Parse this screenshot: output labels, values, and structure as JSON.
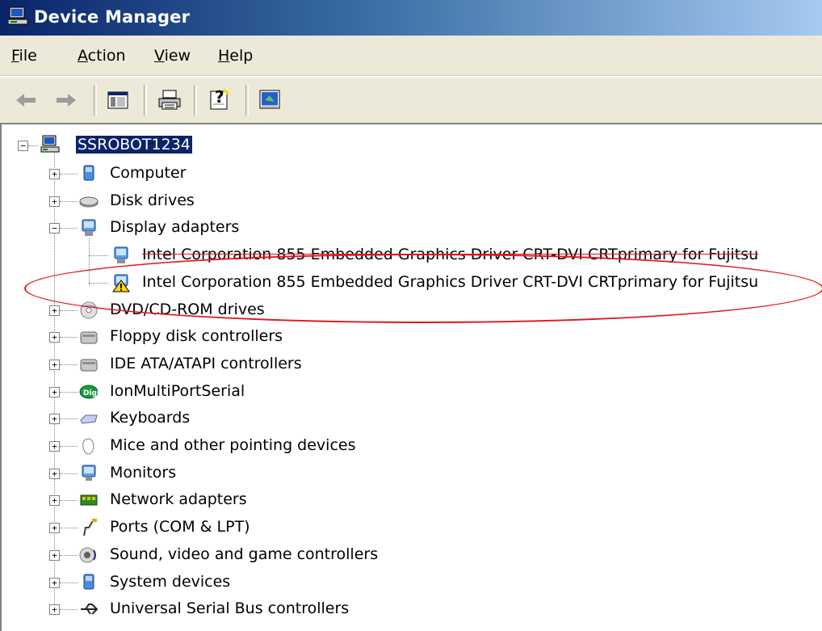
{
  "window": {
    "title": "Device Manager"
  },
  "menu": [
    {
      "label": "File",
      "key": "F"
    },
    {
      "label": "Action",
      "key": "A"
    },
    {
      "label": "View",
      "key": "V"
    },
    {
      "label": "Help",
      "key": "H"
    }
  ],
  "toolbar": {
    "buttons": [
      "back-arrow-icon",
      "forward-arrow-icon",
      "show-hide-console-tree-icon",
      "print-icon",
      "help-icon",
      "properties-icon"
    ]
  },
  "tree": {
    "root": "SSROBOT1234",
    "categories": [
      {
        "label": "Computer",
        "icon": "computer-icon",
        "expanded": false
      },
      {
        "label": "Disk drives",
        "icon": "disk-drive-icon",
        "expanded": false
      },
      {
        "label": "Display adapters",
        "icon": "display-adapter-icon",
        "expanded": true,
        "children": [
          {
            "label": "Intel Corporation 855 Embedded Graphics Driver CRT-DVI CRTprimary for Fujitsu",
            "icon": "display-adapter-icon",
            "warning": false,
            "strikethrough": true
          },
          {
            "label": "Intel Corporation 855 Embedded Graphics Driver CRT-DVI CRTprimary for Fujitsu",
            "icon": "display-adapter-warning-icon",
            "warning": true,
            "strikethrough": false
          }
        ]
      },
      {
        "label": "DVD/CD-ROM drives",
        "icon": "dvd-drive-icon",
        "expanded": false
      },
      {
        "label": "Floppy disk controllers",
        "icon": "floppy-controller-icon",
        "expanded": false
      },
      {
        "label": "IDE ATA/ATAPI controllers",
        "icon": "ide-controller-icon",
        "expanded": false
      },
      {
        "label": "IonMultiPortSerial",
        "icon": "digi-multiport-icon",
        "expanded": false
      },
      {
        "label": "Keyboards",
        "icon": "keyboard-icon",
        "expanded": false
      },
      {
        "label": "Mice and other pointing devices",
        "icon": "mouse-icon",
        "expanded": false
      },
      {
        "label": "Monitors",
        "icon": "monitor-icon",
        "expanded": false
      },
      {
        "label": "Network adapters",
        "icon": "network-adapter-icon",
        "expanded": false
      },
      {
        "label": "Ports (COM & LPT)",
        "icon": "port-icon",
        "expanded": false
      },
      {
        "label": "Sound, video and game controllers",
        "icon": "sound-icon",
        "expanded": false
      },
      {
        "label": "System devices",
        "icon": "system-device-icon",
        "expanded": false
      },
      {
        "label": "Universal Serial Bus controllers",
        "icon": "usb-icon",
        "expanded": false
      }
    ]
  },
  "colors": {
    "title_start": "#0a246a",
    "title_end": "#a6caf0",
    "selection": "#0a246a",
    "annotation": "#e3161d",
    "warning": "#ffd800"
  }
}
